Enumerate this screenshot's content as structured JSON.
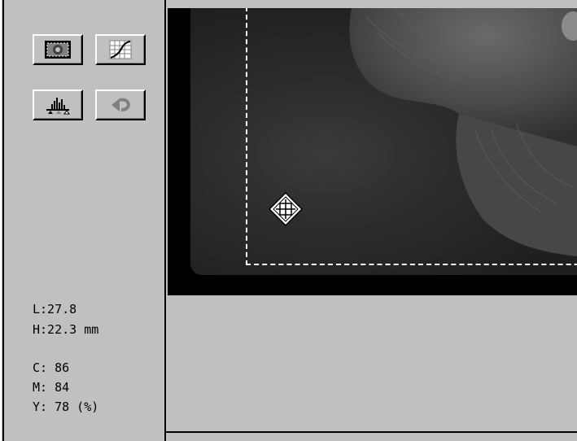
{
  "toolbar": {
    "buttons": [
      {
        "name": "auto-exposure-button",
        "icon": "image-frame-icon"
      },
      {
        "name": "tone-curve-button",
        "icon": "curve-grid-icon"
      },
      {
        "name": "histogram-button",
        "icon": "histogram-icon"
      },
      {
        "name": "undo-button",
        "icon": "undo-arrow-icon"
      }
    ]
  },
  "readout": {
    "length": "L:27.8",
    "height": "H:22.3 mm",
    "cyan": "C: 86",
    "magenta": "M: 84",
    "yellow": "Y: 78 (%)"
  },
  "preview": {
    "cursor_icon": "move-cursor-icon"
  },
  "colors": {
    "panel": "#c0c0c0",
    "preview_bg": "#000000",
    "marquee": "#ffffff"
  }
}
